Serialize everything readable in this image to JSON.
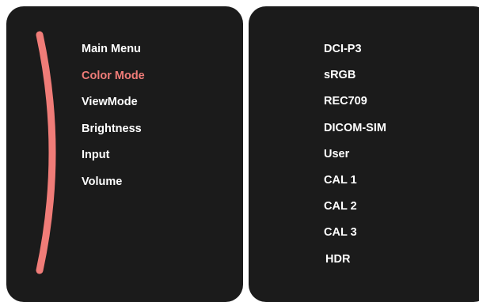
{
  "colors": {
    "panel_bg": "#1b1b1b",
    "text": "#ffffff",
    "accent": "#f07c78"
  },
  "main_menu": {
    "items": [
      {
        "label": "Main Menu",
        "active": false
      },
      {
        "label": "Color Mode",
        "active": true
      },
      {
        "label": "ViewMode",
        "active": false
      },
      {
        "label": "Brightness",
        "active": false
      },
      {
        "label": "Input",
        "active": false
      },
      {
        "label": "Volume",
        "active": false
      }
    ]
  },
  "color_mode_options": {
    "items": [
      {
        "label": "DCI-P3"
      },
      {
        "label": "sRGB"
      },
      {
        "label": "REC709"
      },
      {
        "label": "DICOM-SIM"
      },
      {
        "label": "User"
      },
      {
        "label": "CAL 1"
      },
      {
        "label": "CAL 2"
      },
      {
        "label": "CAL 3"
      },
      {
        "label": "HDR"
      }
    ]
  },
  "icons": {
    "scroll_arc": "curved-scroll-indicator-icon"
  }
}
